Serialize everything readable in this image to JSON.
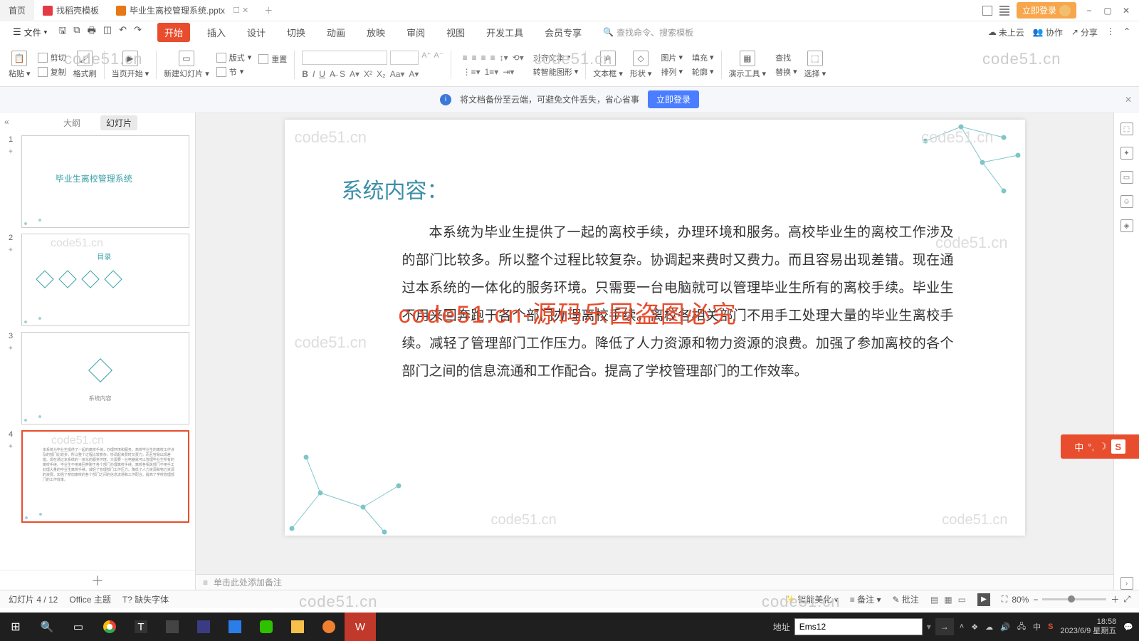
{
  "titlebar": {
    "home": "首页",
    "template": "找稻壳模板",
    "file": "毕业生离校管理系统.pptx",
    "login": "立即登录"
  },
  "menubar": {
    "file_btn": "文件",
    "tabs": [
      "开始",
      "插入",
      "设计",
      "切换",
      "动画",
      "放映",
      "审阅",
      "视图",
      "开发工具",
      "会员专享"
    ],
    "search_placeholder": "查找命令、搜索模板",
    "cloud": "未上云",
    "collab": "协作",
    "share": "分享"
  },
  "ribbon": {
    "paste": "粘贴",
    "cut": "剪切",
    "copy": "复制",
    "format_painter": "格式刷",
    "from_current": "当页开始",
    "new_slide": "新建幻灯片",
    "layout": "版式",
    "section": "节",
    "reset": "重置",
    "align_text": "对齐文本",
    "smart_shape": "转智能图形",
    "textbox": "文本框",
    "shape": "形状",
    "image": "图片",
    "arrange": "排列",
    "fill": "填充",
    "outline": "轮廓",
    "find": "查找",
    "show_tools": "演示工具",
    "replace": "替换",
    "select": "选择"
  },
  "banner": {
    "text": "将文档备份至云端，可避免文件丢失，省心省事",
    "button": "立即登录"
  },
  "sidebar": {
    "outline": "大纲",
    "slides": "幻灯片",
    "thumb1_title": "毕业生离校管理系统",
    "thumb2_title": "目录",
    "thumb3_title": "系统内容",
    "thumb4_title": "系统内容"
  },
  "slide": {
    "title": "系统内容：",
    "body": "本系统为毕业生提供了一起的离校手续，办理环境和服务。高校毕业生的离校工作涉及的部门比较多。所以整个过程比较复杂。协调起来费时又费力。而且容易出现差错。现在通过本系统的一体化的服务环境。只需要一台电脑就可以管理毕业生所有的离校手续。毕业生不用来回奔跑于各个部门办理离校手续。离校各相关部门不用手工处理大量的毕业生离校手续。减轻了管理部门工作压力。降低了人力资源和物力资源的浪费。加强了参加离校的各个部门之间的信息流通和工作配合。提高了学校管理部门的工作效率。",
    "watermark": "code51.cn",
    "overlay": "code51.cn-源码乐园盗图必究"
  },
  "notes_placeholder": "单击此处添加备注",
  "status": {
    "slide_info": "幻灯片 4 / 12",
    "theme": "Office 主题",
    "missing_fonts": "缺失字体",
    "smart_beautify": "智能美化",
    "notes": "备注",
    "comments": "批注",
    "zoom": "80%"
  },
  "taskbar": {
    "address_label": "地址",
    "address_value": "Ems12",
    "time": "18:58",
    "date": "2023/6/9 星期五"
  },
  "float_widget": "中"
}
